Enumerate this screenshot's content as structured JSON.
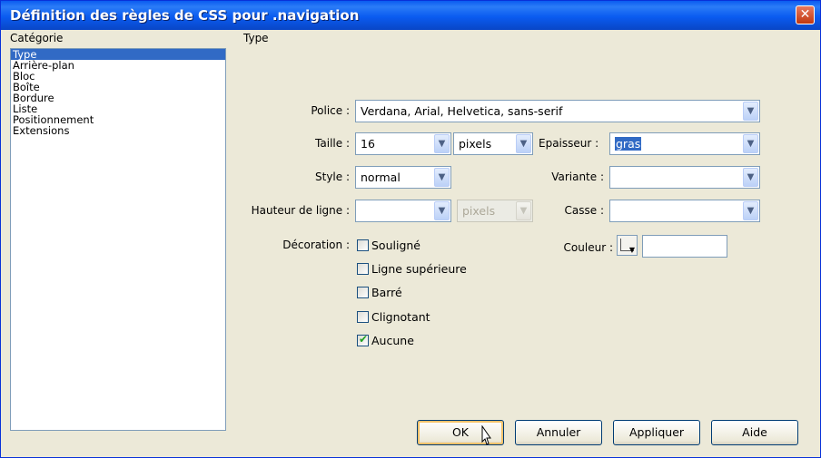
{
  "dialog": {
    "title": "Définition des règles de CSS pour .navigation",
    "close_glyph": "✕"
  },
  "category": {
    "header": "Catégorie",
    "items": [
      "Type",
      "Arrière-plan",
      "Bloc",
      "Boîte",
      "Bordure",
      "Liste",
      "Positionnement",
      "Extensions"
    ],
    "selected": "Type"
  },
  "panel": {
    "header": "Type"
  },
  "font": {
    "label": "Police :",
    "value": "Verdana, Arial, Helvetica, sans-serif"
  },
  "size": {
    "label": "Taille :",
    "value": "16",
    "unit": "pixels"
  },
  "weight": {
    "label": "Epaisseur :",
    "value": "gras"
  },
  "style": {
    "label": "Style :",
    "value": "normal"
  },
  "variant": {
    "label": "Variante :",
    "value": ""
  },
  "line_height": {
    "label": "Hauteur de ligne :",
    "value": "",
    "unit": "pixels"
  },
  "case": {
    "label": "Casse :",
    "value": ""
  },
  "decoration": {
    "label": "Décoration :",
    "options": [
      {
        "label": "Souligné",
        "checked": false
      },
      {
        "label": "Ligne supérieure",
        "checked": false
      },
      {
        "label": "Barré",
        "checked": false
      },
      {
        "label": "Clignotant",
        "checked": false
      },
      {
        "label": "Aucune",
        "checked": true
      }
    ]
  },
  "color": {
    "label": "Couleur :",
    "value": ""
  },
  "buttons": {
    "ok": "OK",
    "cancel": "Annuler",
    "apply": "Appliquer",
    "help": "Aide"
  },
  "icons": {
    "dropdown": "▼",
    "check": "✔"
  },
  "colors": {
    "title_bar": "#0a5bf0",
    "selection": "#316ac5",
    "dialog_bg": "#ece9d8"
  }
}
